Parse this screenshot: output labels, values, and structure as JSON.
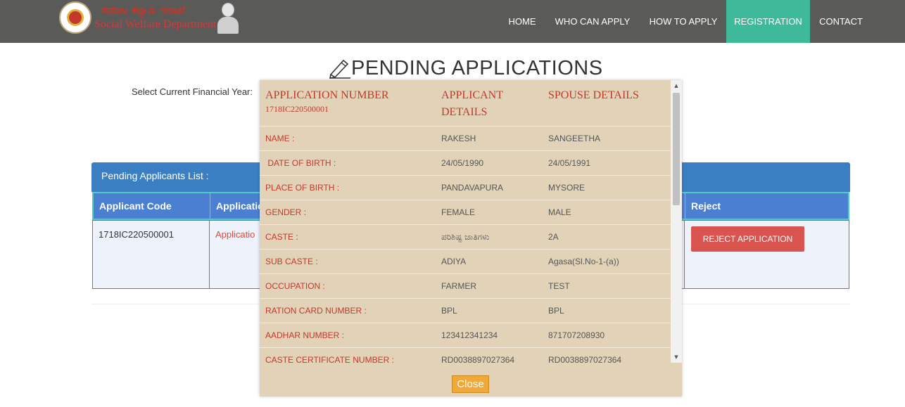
{
  "header": {
    "logo_kannada": "ಸಮಾಜ ಕಲ್ಯಾಣ ಇಲಾಖೆ",
    "logo_english": "Social Welfare Department",
    "nav": [
      {
        "label": "HOME"
      },
      {
        "label": "WHO CAN APPLY"
      },
      {
        "label": "HOW TO APPLY"
      },
      {
        "label": "REGISTRATION",
        "active": true
      },
      {
        "label": "CONTACT"
      }
    ],
    "active_color": "#3eb99a"
  },
  "page": {
    "title": "PENDING APPLICATIONS",
    "fy_label": "Select Current Financial Year:"
  },
  "panel": {
    "heading": "Pending Applicants List :",
    "columns": [
      "Applicant Code",
      "Applicatio",
      "Reject"
    ],
    "row": {
      "code": "1718IC220500001",
      "link": "Applicatio",
      "reject_label": "REJECT APPLICATION"
    }
  },
  "modal": {
    "col_titles": {
      "application": "APPLICATION NUMBER",
      "applicant": "APPLICANT DETAILS",
      "spouse": "SPOUSE DETAILS"
    },
    "application_number": "1718IC220500001",
    "rows": [
      {
        "label": "NAME :",
        "applicant": "RAKESH",
        "spouse": "SANGEETHA"
      },
      {
        "label": " DATE OF BIRTH :",
        "applicant": "24/05/1990",
        "spouse": "24/05/1991"
      },
      {
        "label": "PLACE OF BIRTH :",
        "applicant": "PANDAVAPURA",
        "spouse": "MYSORE"
      },
      {
        "label": "GENDER :",
        "applicant": "FEMALE",
        "spouse": "MALE"
      },
      {
        "label": "CASTE :",
        "applicant": "ಪರಿಶಿಷ್ಟ ಜಾತಿಗಳು",
        "spouse": "2A"
      },
      {
        "label": "SUB CASTE :",
        "applicant": "ADIYA",
        "spouse": "Agasa(Sl.No-1-(a))"
      },
      {
        "label": "OCCUPATION :",
        "applicant": "FARMER",
        "spouse": "TEST"
      },
      {
        "label": "RATION CARD NUMBER :",
        "applicant": "BPL",
        "spouse": "BPL"
      },
      {
        "label": "AADHAR NUMBER :",
        "applicant": "123412341234",
        "spouse": "871707208930"
      },
      {
        "label": "CASTE CERTIFICATE NUMBER :",
        "applicant": "RD0038897027364",
        "spouse": "RD0038897027364"
      }
    ],
    "close_label": "Close"
  },
  "colors": {
    "navbar": "#5a5a59",
    "panel_heading": "#3a7fc2",
    "table_header": "#4b7fd1",
    "modal_bg": "#e2d3b8",
    "label_red": "#c0392b",
    "reject_button": "#d9534f",
    "close_button": "#f0a838"
  }
}
